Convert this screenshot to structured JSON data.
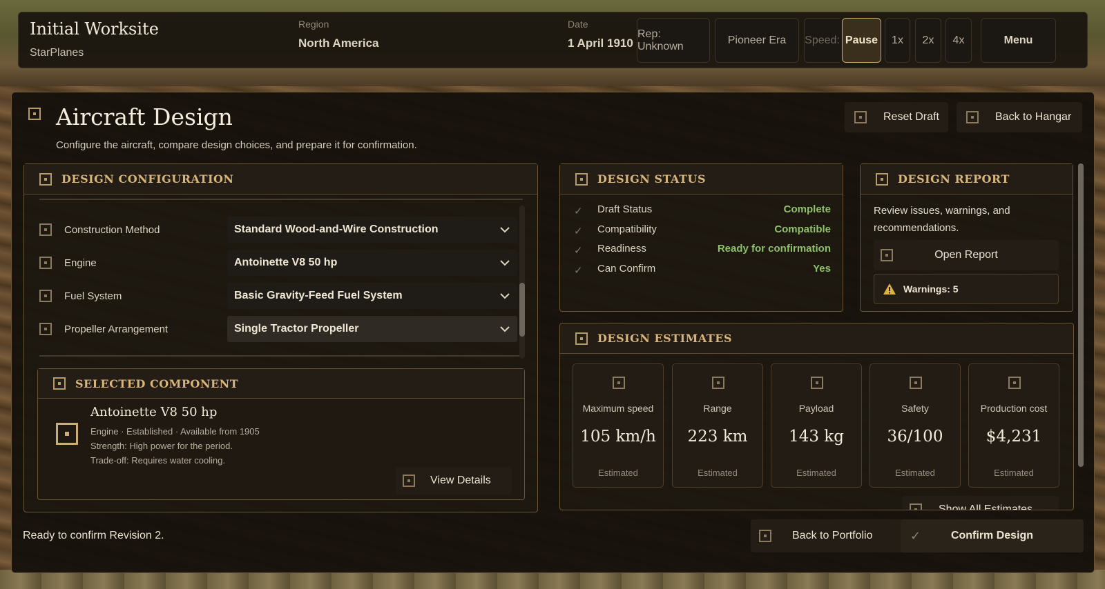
{
  "worksite": {
    "title": "Initial Worksite",
    "company": "StarPlanes"
  },
  "topbar": {
    "region_label": "Region",
    "region_value": "North America",
    "date_label": "Date",
    "date_value": "1 April 1910",
    "rep": "Rep: Unknown",
    "era": "Pioneer Era",
    "speed_label": "Speed:",
    "speed_options": [
      "Pause",
      "1x",
      "2x",
      "4x"
    ],
    "menu": "Menu"
  },
  "header": {
    "title": "Aircraft Design",
    "subtitle": "Configure the aircraft, compare design choices, and prepare it for confirmation.",
    "reset": "Reset Draft",
    "back_hangar": "Back to Hangar"
  },
  "config": {
    "title": "DESIGN CONFIGURATION",
    "rows": [
      {
        "label": "Construction Method",
        "value": "Standard Wood-and-Wire Construction"
      },
      {
        "label": "Engine",
        "value": "Antoinette V8 50 hp"
      },
      {
        "label": "Fuel System",
        "value": "Basic Gravity-Feed Fuel System"
      },
      {
        "label": "Propeller Arrangement",
        "value": "Single Tractor Propeller"
      }
    ]
  },
  "selected": {
    "title": "SELECTED COMPONENT",
    "name": "Antoinette V8 50 hp",
    "meta": "Engine · Established · Available from 1905",
    "strength": "Strength: High power for the period.",
    "tradeoff": "Trade-off: Requires water cooling.",
    "view": "View Details"
  },
  "status": {
    "title": "DESIGN STATUS",
    "rows": [
      {
        "label": "Draft Status",
        "value": "Complete"
      },
      {
        "label": "Compatibility",
        "value": "Compatible"
      },
      {
        "label": "Readiness",
        "value": "Ready for confirmation"
      },
      {
        "label": "Can Confirm",
        "value": "Yes"
      }
    ]
  },
  "report": {
    "title": "DESIGN REPORT",
    "text": "Review issues, warnings, and recommendations.",
    "open": "Open Report",
    "warnings": "Warnings: 5"
  },
  "estimates": {
    "title": "DESIGN ESTIMATES",
    "cards": [
      {
        "name": "Maximum speed",
        "value": "105 km/h",
        "note": "Estimated"
      },
      {
        "name": "Range",
        "value": "223 km",
        "note": "Estimated"
      },
      {
        "name": "Payload",
        "value": "143 kg",
        "note": "Estimated"
      },
      {
        "name": "Safety",
        "value": "36/100",
        "note": "Estimated"
      },
      {
        "name": "Production cost",
        "value": "$4,231",
        "note": "Estimated"
      }
    ],
    "show_all": "Show All Estimates"
  },
  "footer": {
    "status": "Ready to confirm Revision 2.",
    "back_portfolio": "Back to Portfolio",
    "confirm": "Confirm Design"
  },
  "colors": {
    "accent": "#d8b57a",
    "ok": "#8fc06a",
    "panel": "#1e1811"
  }
}
